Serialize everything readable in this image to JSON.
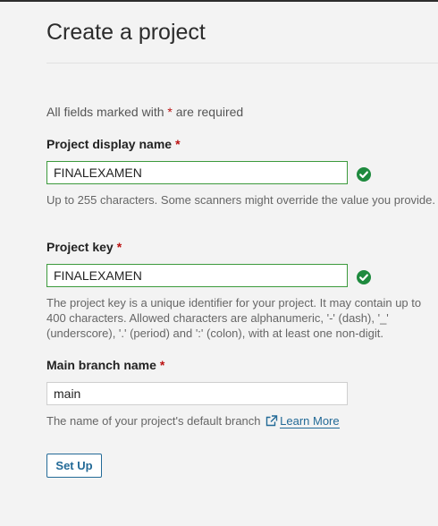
{
  "header": {
    "title": "Create a project"
  },
  "form": {
    "required_note_prefix": "All fields marked with ",
    "required_star": "*",
    "required_note_suffix": " are required",
    "display_name": {
      "label": "Project display name",
      "value": "FINALEXAMEN",
      "help": "Up to 255 characters. Some scanners might override the value you provide.",
      "status": "valid"
    },
    "project_key": {
      "label": "Project key",
      "value": "FINALEXAMEN",
      "help": "The project key is a unique identifier for your project. It may contain up to 400 characters. Allowed characters are alphanumeric, '-' (dash), '_' (underscore), '.' (period) and ':' (colon), with at least one non-digit.",
      "status": "valid"
    },
    "main_branch": {
      "label": "Main branch name",
      "value": "main",
      "help_prefix": "The name of your project's default branch ",
      "learn_more": "Learn More"
    },
    "submit_label": "Set Up"
  },
  "colors": {
    "valid": "#1e8a3e",
    "link": "#236a97",
    "required": "#bb1111"
  },
  "icons": {
    "valid": "check-circle-icon",
    "external": "external-link-icon"
  }
}
